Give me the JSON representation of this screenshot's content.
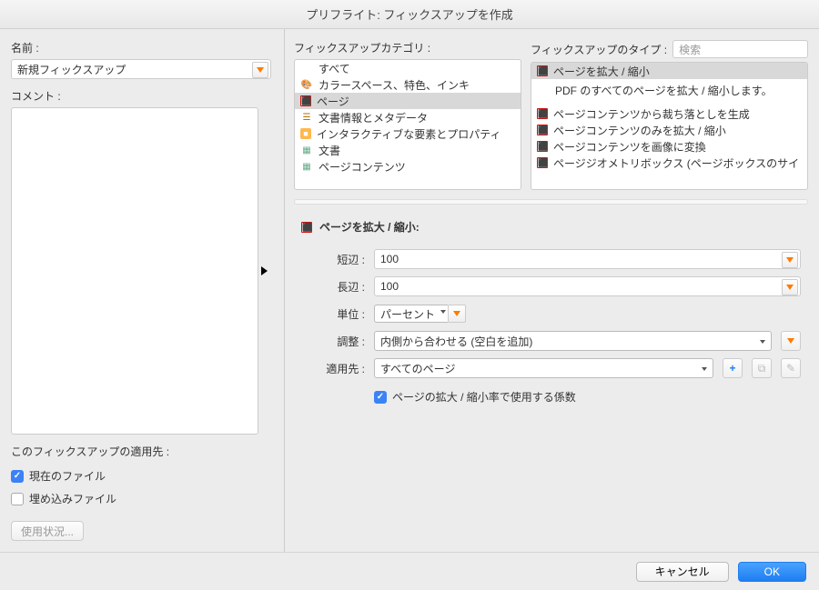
{
  "title": "プリフライト: フィックスアップを作成",
  "left": {
    "nameLabel": "名前 :",
    "nameValue": "新規フィックスアップ",
    "commentLabel": "コメント :",
    "applyLabel": "このフィックスアップの適用先 :",
    "chkCurrent": "現在のファイル",
    "chkEmbedded": "埋め込みファイル",
    "usage": "使用状況..."
  },
  "cat": {
    "label": "フィックスアップカテゴリ :",
    "items": [
      "すべて",
      "カラースペース、特色、インキ",
      "ページ",
      "文書情報とメタデータ",
      "インタラクティブな要素とプロパティ",
      "文書",
      "ページコンテンツ"
    ]
  },
  "type": {
    "label": "フィックスアップのタイプ :",
    "search": "検索",
    "items": [
      "ページを拡大 / 縮小",
      "ページコンテンツから裁ち落としを生成",
      "ページコンテンツのみを拡大 / 縮小",
      "ページコンテンツを画像に変換",
      "ページジオメトリボックス (ページボックスのサイ"
    ],
    "desc": "PDF のすべてのページを拡大 / 縮小します。"
  },
  "form": {
    "title": "ページを拡大 / 縮小:",
    "shortLabel": "短辺 :",
    "shortValue": "100",
    "longLabel": "長辺 :",
    "longValue": "100",
    "unitLabel": "単位 :",
    "unitValue": "パーセント",
    "adjustLabel": "調整 :",
    "adjustValue": "内側から合わせる (空白を追加)",
    "applyToLabel": "適用先 :",
    "applyToValue": "すべてのページ",
    "checkbox": "ページの拡大 / 縮小率で使用する係数"
  },
  "footer": {
    "cancel": "キャンセル",
    "ok": "OK"
  }
}
